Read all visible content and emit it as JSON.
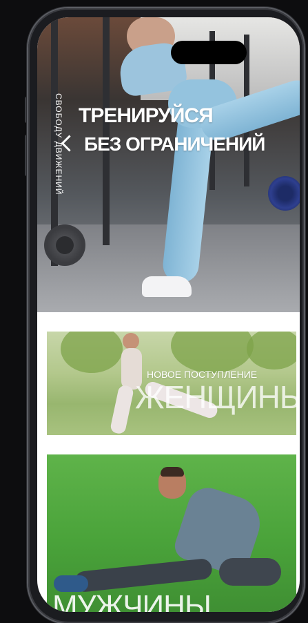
{
  "hero": {
    "title_line1": "ТРЕНИРУЙСЯ",
    "title_line2": "БЕЗ ОГРАНИЧЕНИЙ",
    "vertical_text": "СВОБОДУ ДВИЖЕНИЙ"
  },
  "cards": [
    {
      "subtitle": "НОВОЕ ПОСТУПЛЕНИЕ",
      "title": "ЖЕНЩИНЫ"
    },
    {
      "title": "МУЖЧИНЫ"
    }
  ],
  "colors": {
    "accent_light_blue": "#9cc4dd",
    "grass_green": "#4aa33a"
  },
  "icons": [
    "chevron-left-icon"
  ]
}
